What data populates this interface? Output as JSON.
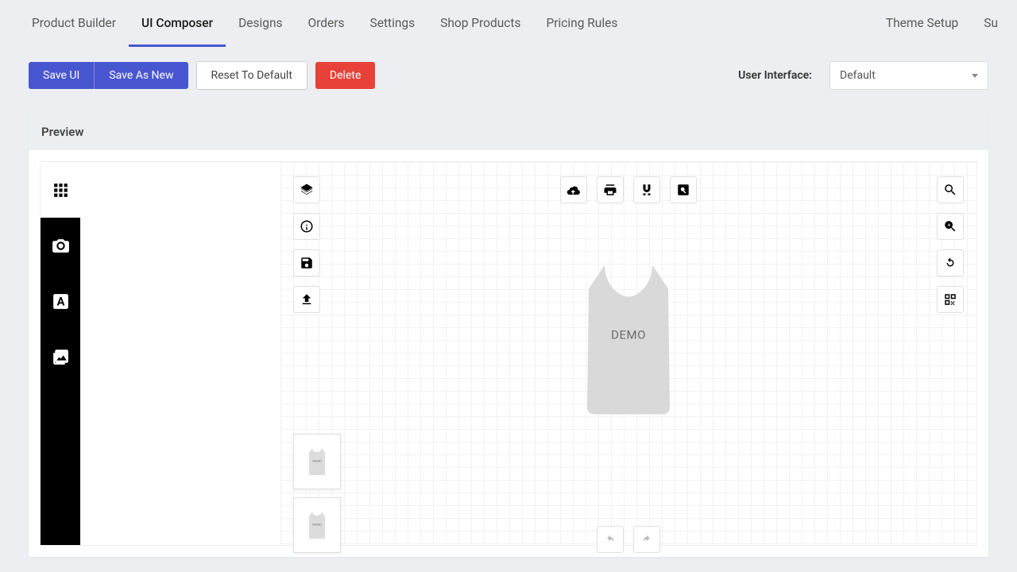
{
  "nav": {
    "items": [
      "Product Builder",
      "UI Composer",
      "Designs",
      "Orders",
      "Settings",
      "Shop Products",
      "Pricing Rules"
    ],
    "active_index": 1,
    "right_items": [
      "Theme Setup",
      "Su"
    ]
  },
  "toolbar": {
    "save_ui": "Save UI",
    "save_as_new": "Save As New",
    "reset": "Reset To Default",
    "delete": "Delete",
    "ui_label": "User Interface:",
    "ui_selected": "Default"
  },
  "preview": {
    "header": "Preview",
    "demo_text": "DEMO"
  },
  "icons": {
    "grid": "apps-icon",
    "camera": "camera-icon",
    "text": "text-icon",
    "image": "image-icon",
    "layers": "layers-icon",
    "info": "info-icon",
    "save": "save-icon",
    "upload": "upload-icon",
    "cloud_upload": "cloud-upload-icon",
    "print": "print-icon",
    "magnet": "magnet-icon",
    "pageview": "preview-icon",
    "search": "search-icon",
    "zoom_in": "zoom-in-icon",
    "refresh": "refresh-icon",
    "qr": "qr-icon",
    "undo": "undo-icon",
    "redo": "redo-icon"
  }
}
